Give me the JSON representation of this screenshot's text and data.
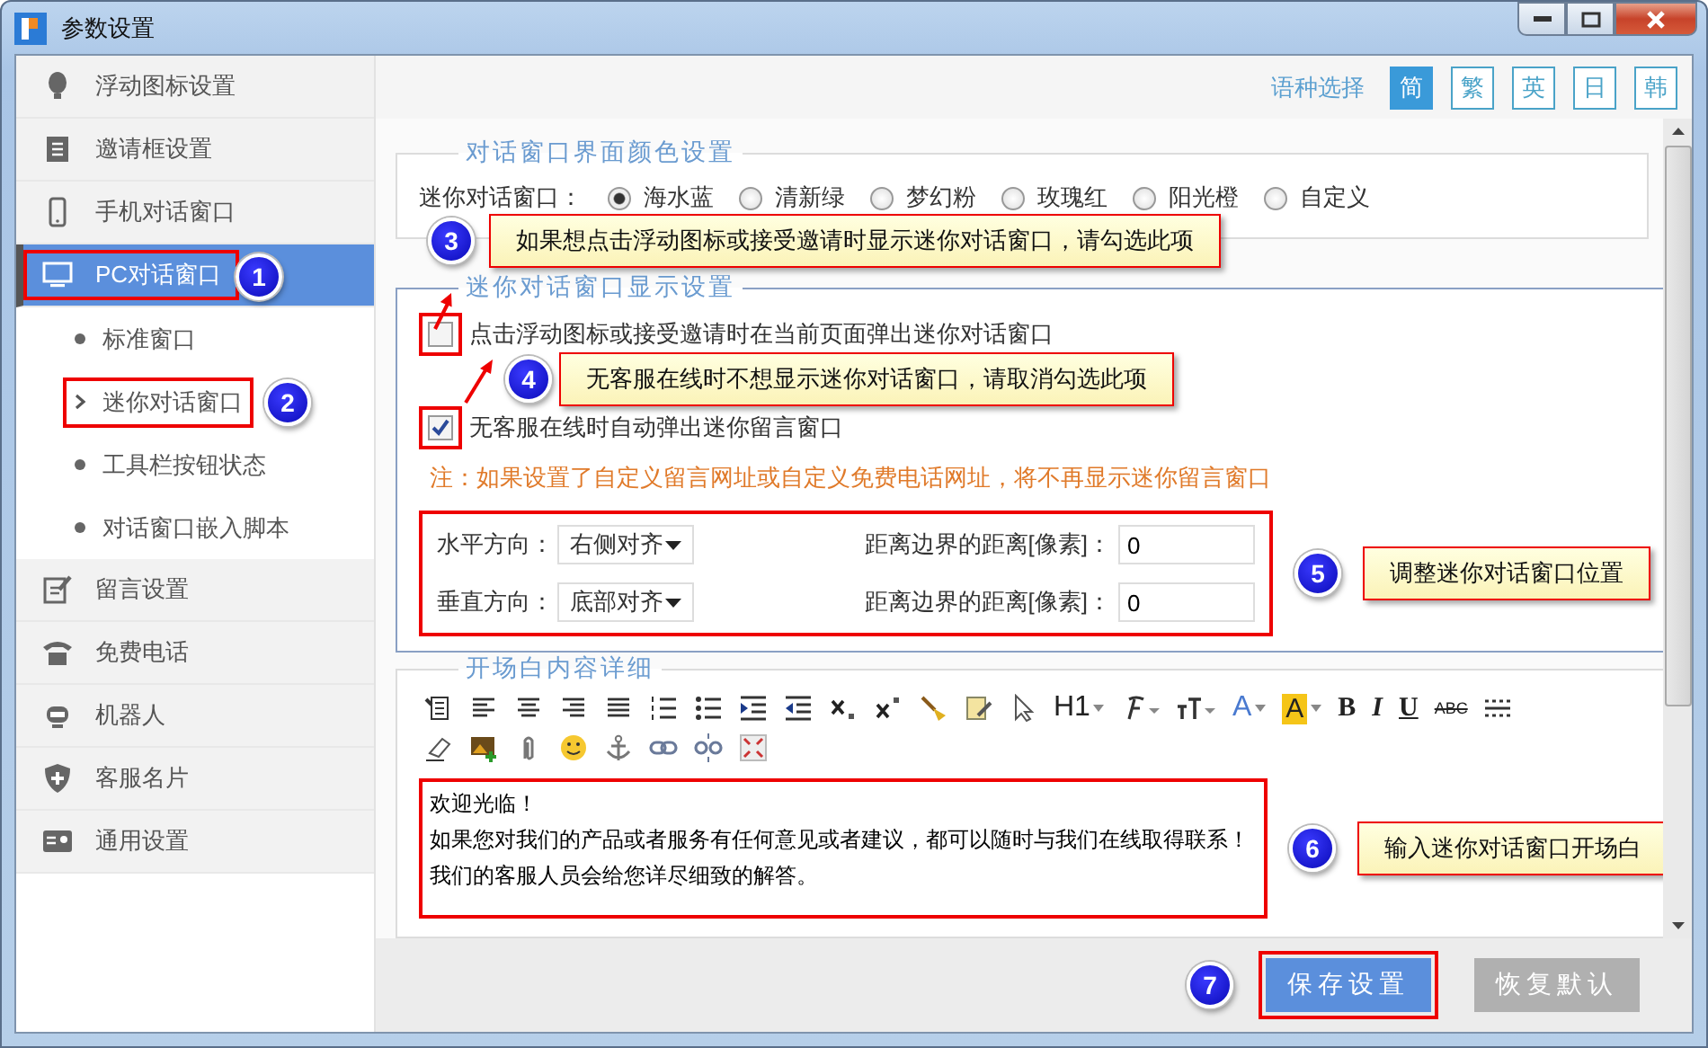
{
  "window": {
    "title": "参数设置"
  },
  "sidebar": {
    "items": [
      {
        "label": "浮动图标设置",
        "selected": false,
        "highlighted": false
      },
      {
        "label": "邀请框设置",
        "selected": false,
        "highlighted": false
      },
      {
        "label": "手机对话窗口",
        "selected": false,
        "highlighted": false
      },
      {
        "label": "PC对话窗口",
        "selected": true,
        "highlighted": true,
        "badge": "1",
        "children": [
          {
            "label": "标准窗口",
            "selected": false,
            "highlighted": false
          },
          {
            "label": "迷你对话窗口",
            "selected": true,
            "highlighted": true,
            "badge": "2"
          },
          {
            "label": "工具栏按钮状态",
            "selected": false,
            "highlighted": false
          },
          {
            "label": "对话窗口嵌入脚本",
            "selected": false,
            "highlighted": false
          }
        ]
      },
      {
        "label": "留言设置",
        "selected": false,
        "highlighted": false
      },
      {
        "label": "免费电话",
        "selected": false,
        "highlighted": false
      },
      {
        "label": "机器人",
        "selected": false,
        "highlighted": false
      },
      {
        "label": "客服名片",
        "selected": false,
        "highlighted": false
      },
      {
        "label": "通用设置",
        "selected": false,
        "highlighted": false
      }
    ]
  },
  "language": {
    "label": "语种选择",
    "options": [
      {
        "label": "简",
        "selected": true
      },
      {
        "label": "繁",
        "selected": false
      },
      {
        "label": "英",
        "selected": false
      },
      {
        "label": "日",
        "selected": false
      },
      {
        "label": "韩",
        "selected": false
      }
    ]
  },
  "color_section": {
    "title": "对话窗口界面颜色设置",
    "label": "迷你对话窗口：",
    "options": [
      {
        "label": "海水蓝",
        "selected": true
      },
      {
        "label": "清新绿",
        "selected": false
      },
      {
        "label": "梦幻粉",
        "selected": false
      },
      {
        "label": "玫瑰红",
        "selected": false
      },
      {
        "label": "阳光橙",
        "selected": false
      },
      {
        "label": "自定义",
        "selected": false
      }
    ]
  },
  "display_section": {
    "title": "迷你对话窗口显示设置",
    "checkboxes": [
      {
        "label": "点击浮动图标或接受邀请时在当前页面弹出迷你对话窗口",
        "checked": false,
        "highlighted": true,
        "badge": "3",
        "callout": "如果想点击浮动图标或接受邀请时显示迷你对话窗口，请勾选此项"
      },
      {
        "label": "无客服在线时自动弹出迷你留言窗口",
        "checked": true,
        "highlighted": true,
        "badge": "4",
        "callout": "无客服在线时不想显示迷你对话窗口，请取消勾选此项"
      }
    ],
    "note": "注：如果设置了自定义留言网址或自定义免费电话网址，将不再显示迷你留言窗口",
    "position": {
      "highlighted": true,
      "badge": "5",
      "callout": "调整迷你对话窗口位置",
      "rows": [
        {
          "label": "水平方向：",
          "select": "右侧对齐",
          "distance_label": "距离边界的距离[像素]：",
          "distance": "0"
        },
        {
          "label": "垂直方向：",
          "select": "底部对齐",
          "distance_label": "距离边界的距离[像素]：",
          "distance": "0"
        }
      ]
    }
  },
  "greeting_section": {
    "title": "开场白内容详细",
    "toolbar_labels": [
      "H1",
      "A",
      "A",
      "B",
      "I",
      "U",
      "ABC"
    ],
    "highlighted": true,
    "badge": "6",
    "callout": "输入迷你对话窗口开场白",
    "content": [
      "欢迎光临！",
      "如果您对我们的产品或者服务有任何意见或者建议，都可以随时与我们在线取得联系！",
      "我们的客服人员会给您详尽细致的解答。"
    ]
  },
  "footer": {
    "buttons": [
      {
        "label": "保存设置",
        "kind": "primary",
        "highlighted": true,
        "badge": "7"
      },
      {
        "label": "恢复默认",
        "kind": "secondary",
        "highlighted": false
      }
    ]
  }
}
